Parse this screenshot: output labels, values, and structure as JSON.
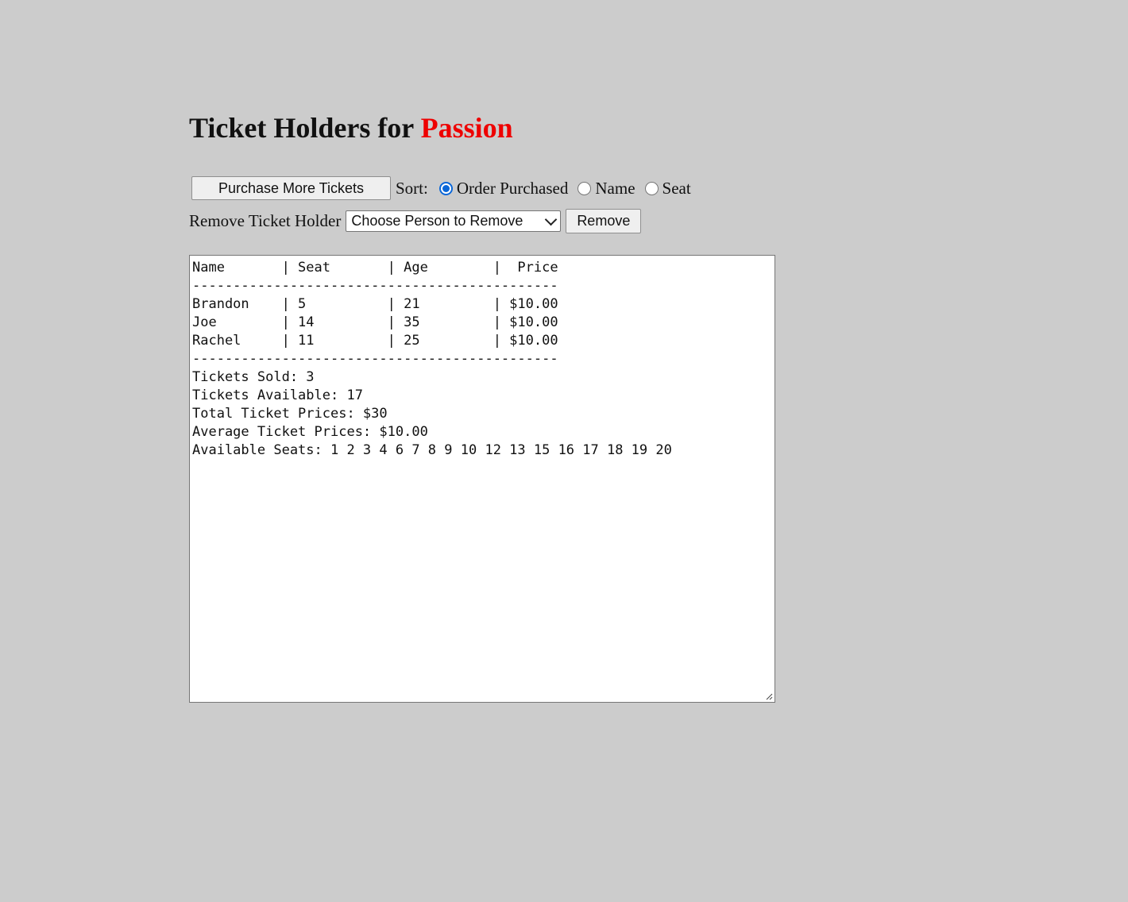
{
  "header": {
    "title_prefix": "Ticket Holders for",
    "show_name": "Passion"
  },
  "colors": {
    "show_name": "#ee0000",
    "background": "#cccccc",
    "radio_accent": "#0b67d8"
  },
  "toolbar": {
    "purchase_label": "Purchase More Tickets",
    "sort_label": "Sort:",
    "sort_options": [
      {
        "label": "Order Purchased",
        "checked": true
      },
      {
        "label": "Name",
        "checked": false
      },
      {
        "label": "Seat",
        "checked": false
      }
    ]
  },
  "remove": {
    "label": "Remove Ticket Holder",
    "select_value": "Choose Person to Remove",
    "button_label": "Remove"
  },
  "report": {
    "lines": [
      "Name       | Seat       | Age        |  Price",
      "---------------------------------------------",
      "Brandon    | 5          | 21         | $10.00",
      "Joe        | 14         | 35         | $10.00",
      "Rachel     | 11         | 25         | $10.00",
      "---------------------------------------------",
      "Tickets Sold: 3",
      "Tickets Available: 17",
      "Total Ticket Prices: $30",
      "Average Ticket Prices: $10.00",
      "Available Seats: 1 2 3 4 6 7 8 9 10 12 13 15 16 17 18 19 20"
    ]
  }
}
